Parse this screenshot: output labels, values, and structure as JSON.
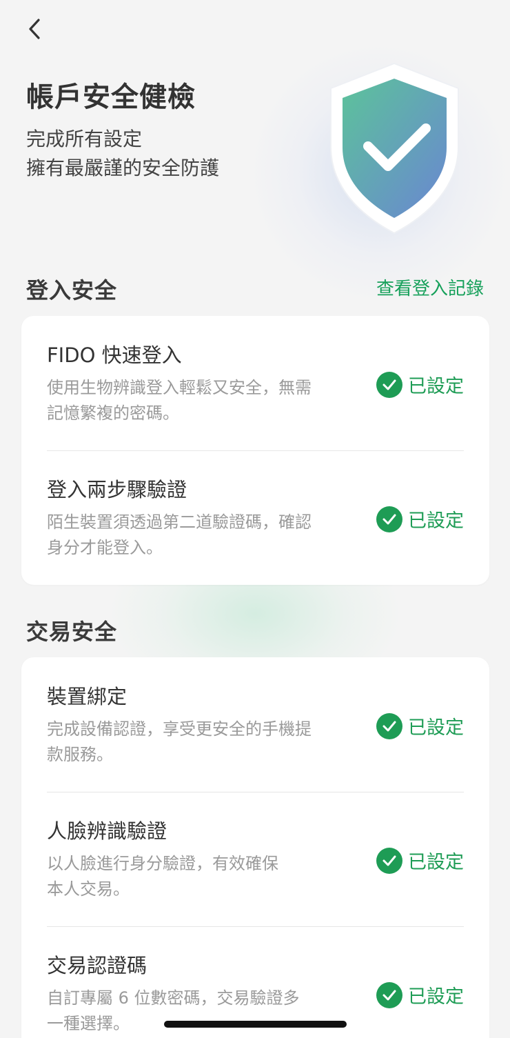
{
  "header": {
    "back_icon": "chevron-left-icon",
    "title": "帳戶安全健檢",
    "subtitle_line1": "完成所有設定",
    "subtitle_line2": "擁有最嚴謹的安全防護",
    "shield_icon": "shield-check-icon"
  },
  "colors": {
    "accent": "#1e9c55",
    "shield_top": "#5cc39a",
    "shield_bottom": "#6a86d2"
  },
  "login_section": {
    "title": "登入安全",
    "link_label": "查看登入記錄",
    "items": [
      {
        "title": "FIDO 快速登入",
        "desc_line1": "使用生物辨識登入輕鬆又安全，無需",
        "desc_line2": "記憶繁複的密碼。",
        "status": "已設定"
      },
      {
        "title": "登入兩步驟驗證",
        "desc_line1": "陌生裝置須透過第二道驗證碼，確認",
        "desc_line2": "身分才能登入。",
        "status": "已設定"
      }
    ]
  },
  "transaction_section": {
    "title": "交易安全",
    "items": [
      {
        "title": "裝置綁定",
        "desc_line1": "完成設備認證，享受更安全的手機提",
        "desc_line2": "款服務。",
        "status": "已設定"
      },
      {
        "title": "人臉辨識驗證",
        "desc_line1": "以人臉進行身分驗證，有效確保",
        "desc_line2": "本人交易。",
        "status": "已設定"
      },
      {
        "title": "交易認證碼",
        "desc_line1": "自訂專屬 6 位數密碼，交易驗證多",
        "desc_line2": "一種選擇。",
        "status": "已設定"
      }
    ]
  }
}
